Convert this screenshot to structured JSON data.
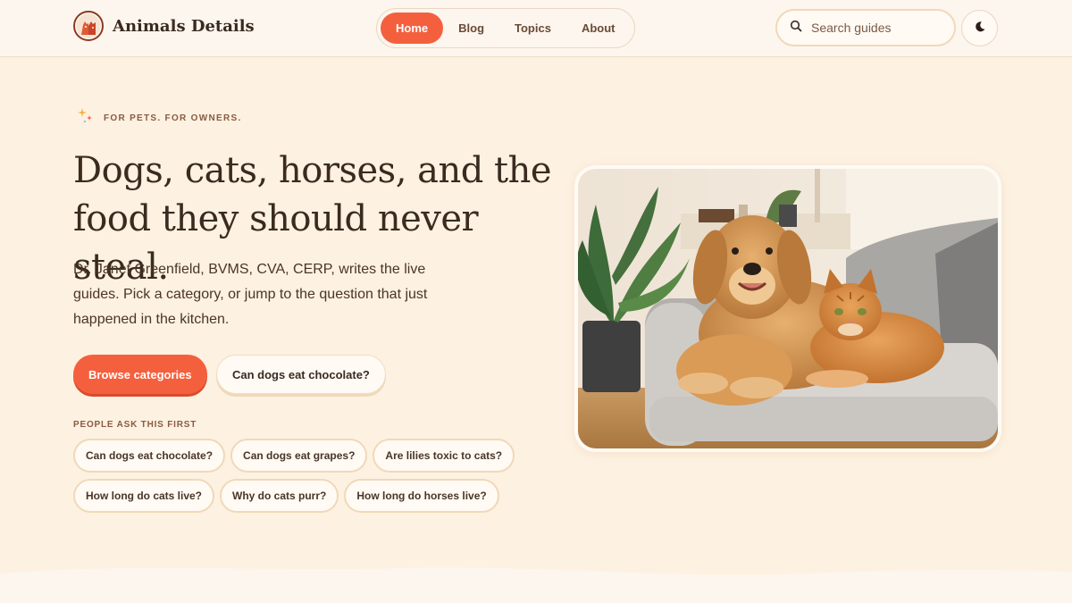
{
  "brand": {
    "name": "Animals Details",
    "logo_icon": "pet-logo-icon"
  },
  "nav": {
    "items": [
      {
        "label": "Home",
        "active": true
      },
      {
        "label": "Blog",
        "active": false
      },
      {
        "label": "Topics",
        "active": false
      },
      {
        "label": "About",
        "active": false
      }
    ]
  },
  "search": {
    "placeholder": "Search guides",
    "icon": "search-icon"
  },
  "theme_toggle": {
    "icon": "moon-icon"
  },
  "hero": {
    "eyebrow": "FOR PETS. FOR OWNERS.",
    "headline": "Dogs, cats, horses, and the food they should never steal.",
    "intro": "Dr. Janet Greenfield, BVMS, CVA, CERP, writes the live guides. Pick a category, or jump to the question that just happened in the kitchen.",
    "primary_cta": "Browse categories",
    "secondary_cta": "Can dogs eat chocolate?"
  },
  "people_ask": {
    "label": "PEOPLE ASK THIS FIRST",
    "rows": [
      [
        "Can dogs eat chocolate?",
        "Can dogs eat grapes?",
        "Are lilies toxic to cats?"
      ],
      [
        "How long do cats live?",
        "Why do cats purr?",
        "How long do horses live?"
      ]
    ]
  },
  "hero_image": {
    "subject": "golden retriever and orange tabby cat on a grey sofa"
  },
  "colors": {
    "accent": "#f4603e",
    "background": "#fdf1e1",
    "header_background": "#fdf6ee",
    "text": "#3a2a20"
  }
}
